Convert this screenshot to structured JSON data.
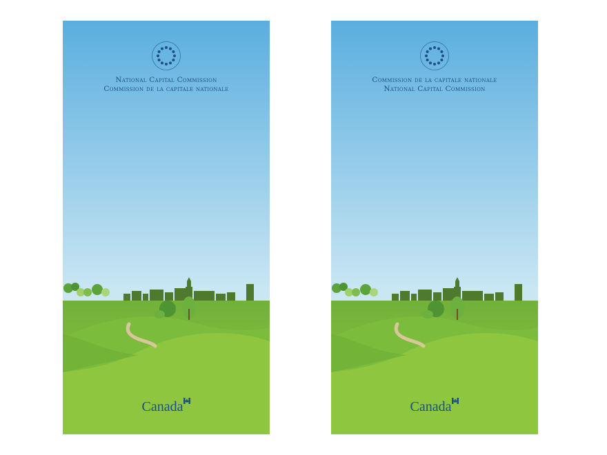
{
  "panels": {
    "left": {
      "title_line_1": "National Capital Commission",
      "title_line_2": "Commission de la capitale nationale"
    },
    "right": {
      "title_line_1": "Commission de la capitale nationale",
      "title_line_2": "National Capital Commission"
    }
  },
  "wordmark": "Canada",
  "colors": {
    "sky_top": "#5aaedf",
    "sky_bottom": "#c9e6f3",
    "grass_light": "#8ec63f",
    "grass_dark": "#5f9f2e",
    "skyline": "#4f7a2e",
    "path": "#d9c79a",
    "text_blue": "#1d4f86",
    "flag_red": "#d52b1e"
  },
  "icons": [
    "ncc-emblem-icon",
    "canada-flag-icon"
  ]
}
